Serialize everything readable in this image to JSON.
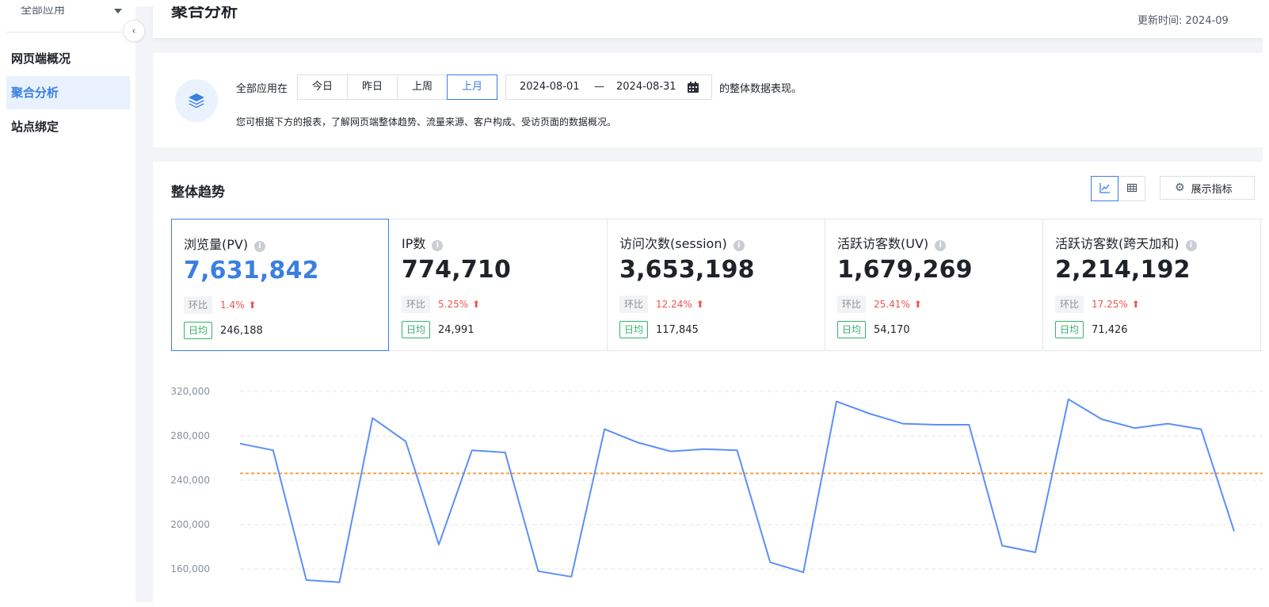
{
  "sidebar": {
    "app_select": "全部应用",
    "items": [
      {
        "label": "网页端概况"
      },
      {
        "label": "聚合分析"
      },
      {
        "label": "站点绑定"
      }
    ]
  },
  "header": {
    "title": "聚合分析",
    "update_time": "更新时间: 2024-09"
  },
  "filter": {
    "prefix": "全部应用在",
    "periods": [
      "今日",
      "昨日",
      "上周",
      "上月"
    ],
    "active_period": "上月",
    "date_start": "2024-08-01",
    "date_sep": "—",
    "date_end": "2024-08-31",
    "suffix": "的整体数据表现。",
    "description": "您可根据下方的报表，了解网页端整体趋势、流量来源、客户构成、受访页面的数据概况。"
  },
  "trend": {
    "title": "整体趋势",
    "metrics_button": "展示指标",
    "kpis": [
      {
        "name": "浏览量(PV)",
        "value": "7,631,842",
        "change_label": "环比",
        "change": "1.4%",
        "avg_label": "日均",
        "avg": "246,188"
      },
      {
        "name": "IP数",
        "value": "774,710",
        "change_label": "环比",
        "change": "5.25%",
        "avg_label": "日均",
        "avg": "24,991"
      },
      {
        "name": "访问次数(session)",
        "value": "3,653,198",
        "change_label": "环比",
        "change": "12.24%",
        "avg_label": "日均",
        "avg": "117,845"
      },
      {
        "name": "活跃访客数(UV)",
        "value": "1,679,269",
        "change_label": "环比",
        "change": "25.41%",
        "avg_label": "日均",
        "avg": "54,170"
      },
      {
        "name": "活跃访客数(跨天加和)",
        "value": "2,214,192",
        "change_label": "环比",
        "change": "17.25%",
        "avg_label": "日均",
        "avg": "71,426"
      }
    ]
  },
  "chart_data": {
    "type": "line",
    "title": "",
    "y_ticks": [
      "320,000",
      "280,000",
      "240,000",
      "200,000",
      "160,000"
    ],
    "ylim": [
      150000,
      330000
    ],
    "grid": true,
    "series": [
      {
        "values": [
          273000,
          267000,
          150000,
          148000,
          296000,
          275000,
          182000,
          267000,
          265000,
          158000,
          153000,
          286000,
          274000,
          266000,
          268000,
          267000,
          166000,
          157000,
          311000,
          300000,
          291000,
          290000,
          290000,
          181000,
          175000,
          313000,
          295000,
          287000,
          291000,
          286000,
          194000
        ],
        "color": "#5b8ff9"
      }
    ],
    "average_line": {
      "value": 246188,
      "color": "#f5a145"
    }
  }
}
